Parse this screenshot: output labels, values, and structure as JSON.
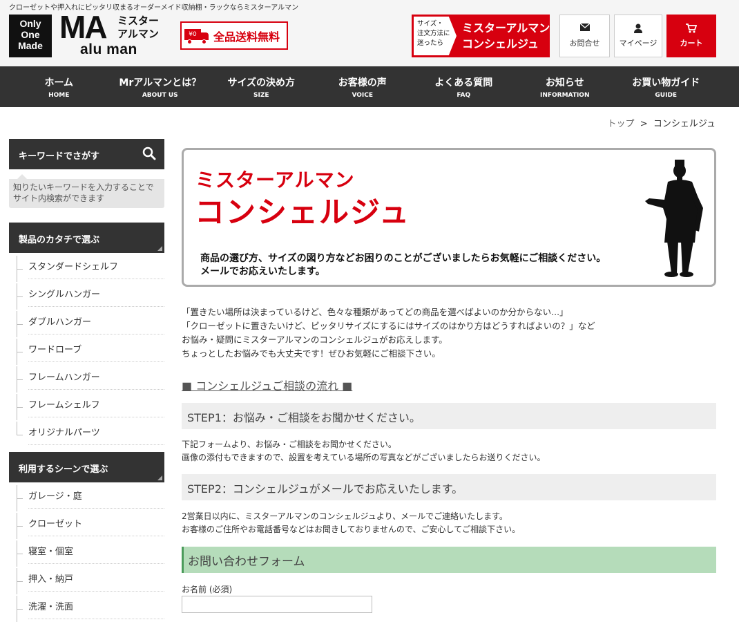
{
  "header": {
    "tagline": "クローゼットや押入れにピッタリ収まるオーダーメイド収納棚・ラックならミスターアルマン",
    "logo_box": [
      "Only",
      "One",
      "Made"
    ],
    "logo_ma": "MA",
    "logo_ja": [
      "ミスター",
      "アルマン"
    ],
    "logo_en": "alu man",
    "free_shipping": "全品送料無料",
    "free_shipping_icon_text": "¥0",
    "concierge_small": [
      "サイズ・",
      "注文方法に",
      "迷ったら"
    ],
    "concierge_title": [
      "ミスターアルマン",
      "コンシェルジュ"
    ],
    "contact_label": "お問合せ",
    "mypage_label": "マイページ",
    "cart_label": "カート"
  },
  "nav": [
    {
      "jp": "ホーム",
      "en": "HOME"
    },
    {
      "jp": "Mrアルマンとは？",
      "en": "ABOUT US"
    },
    {
      "jp": "サイズの決め方",
      "en": "SIZE"
    },
    {
      "jp": "お客様の声",
      "en": "VOICE"
    },
    {
      "jp": "よくある質問",
      "en": "FAQ"
    },
    {
      "jp": "お知らせ",
      "en": "INFORMATION"
    },
    {
      "jp": "お買い物ガイド",
      "en": "GUIDE"
    }
  ],
  "breadcrumb": {
    "top": "トップ",
    "sep": ">",
    "current": "コンシェルジュ"
  },
  "sidebar": {
    "search_title": "キーワードでさがす",
    "search_note": "知りたいキーワードを入力することでサイト内検索ができます",
    "shape_title": "製品のカタチで選ぶ",
    "shape_items": [
      "スタンダードシェルフ",
      "シングルハンガー",
      "ダブルハンガー",
      "ワードローブ",
      "フレームハンガー",
      "フレームシェルフ",
      "オリジナルパーツ"
    ],
    "scene_title": "利用するシーンで選ぶ",
    "scene_items": [
      "ガレージ・庭",
      "クローゼット",
      "寝室・個室",
      "押入・納戸",
      "洗濯・洗面"
    ]
  },
  "banner": {
    "title_small": "ミスターアルマン",
    "title_big": "コンシェルジュ",
    "desc": [
      "商品の選び方、サイズの図り方などお困りのことがございましたらお気軽にご相談ください。",
      "メールでお応えいたします。"
    ]
  },
  "intro": [
    "「置きたい場所は決まっているけど、色々な種類があってどの商品を選べばよいのか分からない...」",
    "「クローゼットに置きたいけど、ピッタリサイズにするにはサイズのはかり方はどうすればよいの？」など",
    "お悩み・疑問にミスターアルマンのコンシェルジュがお応えします。",
    "ちょっとしたお悩みでも大丈夫です！ぜひお気軽にご相談下さい。"
  ],
  "flow_title": "■ コンシェルジュご相談の流れ ■",
  "step1": {
    "title": "STEP1：お悩み・ご相談をお聞かせください。",
    "lines": [
      "下記フォームより、お悩み・ご相談をお聞かせください。",
      "画像の添付もできますので、設置を考えている場所の写真などがございましたらお送りください。"
    ]
  },
  "step2": {
    "title": "STEP2：コンシェルジュがメールでお応えいたします。",
    "lines": [
      "2営業日以内に、ミスターアルマンのコンシェルジュより、メールでご連絡いたします。",
      "お客様のご住所やお電話番号などはお聞きしておりませんので、ご安心してご相談下さい。"
    ]
  },
  "form": {
    "title": "お問い合わせフォーム",
    "name_label": "お名前 (必須)",
    "name_value": ""
  },
  "colors": {
    "brand_red": "#d7000f",
    "nav_bg": "#333333",
    "form_head_bg": "#b5dcba"
  }
}
